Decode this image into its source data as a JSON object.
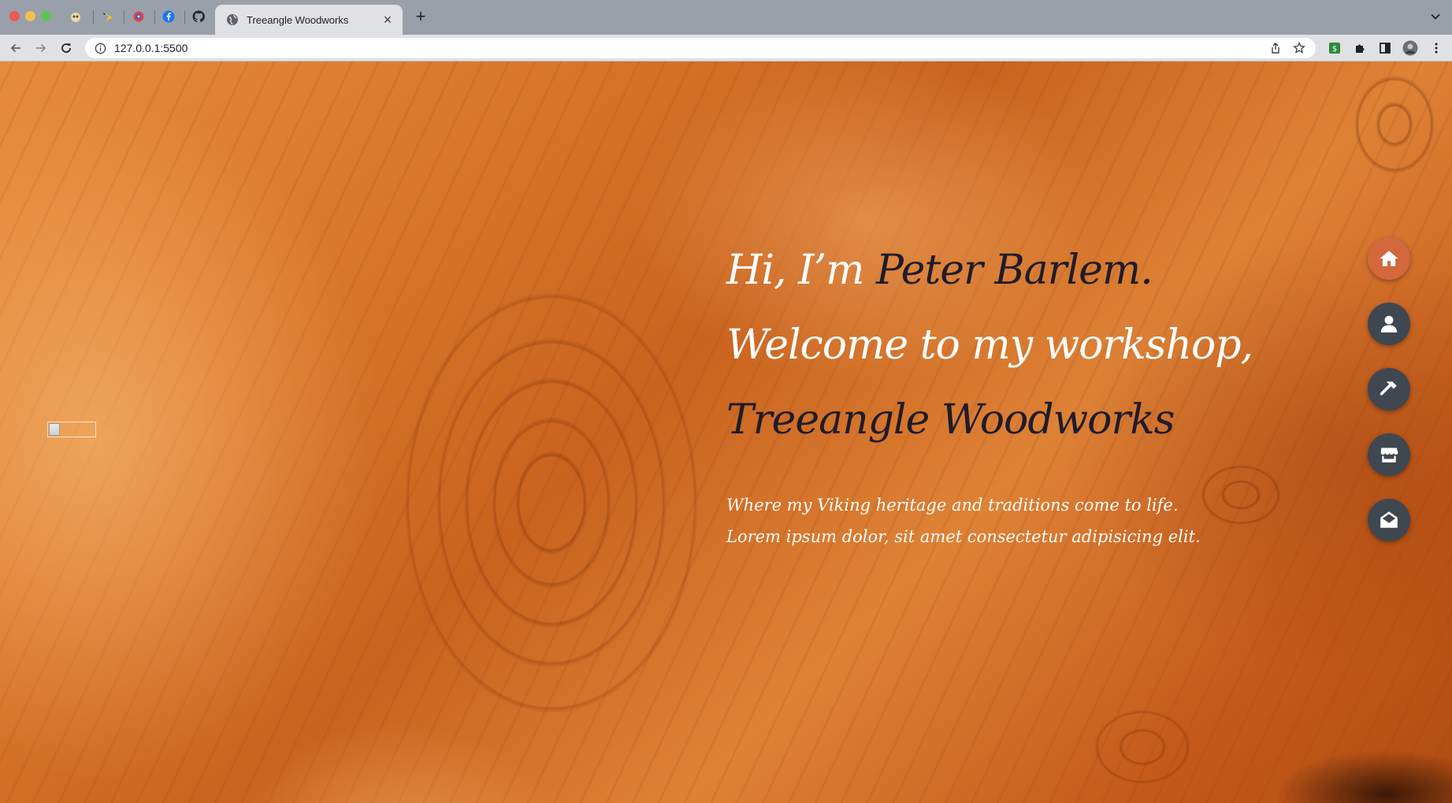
{
  "browser": {
    "pinned_tabs": [
      {
        "icon": "owl-favicon-icon",
        "color": "#d9c27a"
      },
      {
        "icon": "pikachu-favicon-icon",
        "color": "#e8c84a"
      },
      {
        "icon": "ring-favicon-icon",
        "color": "#e0453a"
      },
      {
        "icon": "facebook-icon",
        "color": "#1877f2"
      },
      {
        "icon": "github-icon",
        "color": "#24292f"
      }
    ],
    "active_tab": {
      "title": "Treeangle Woodworks",
      "close": "×"
    },
    "new_tab": "+",
    "address_bar": {
      "url": "127.0.0.1:5500"
    },
    "extension_color": "#2e8b3a"
  },
  "page": {
    "hero": {
      "line1_light": "Hi, I’m ",
      "line1_dark": "Peter Barlem.",
      "line2": "Welcome to my workshop,",
      "line3": "Treeangle Woodworks",
      "sub1": "Where my Viking heritage and traditions come to life.",
      "sub2": "Lorem ipsum dolor, sit amet consectetur adipisicing elit."
    },
    "nav": [
      {
        "icon": "home-icon",
        "active": true
      },
      {
        "icon": "user-icon",
        "active": false
      },
      {
        "icon": "hammer-icon",
        "active": false
      },
      {
        "icon": "store-icon",
        "active": false
      },
      {
        "icon": "envelope-open-icon",
        "active": false
      }
    ],
    "colors": {
      "accent": "#d3683c",
      "nav_bg": "#3f4750",
      "dark_text": "#1f1c2a"
    }
  }
}
